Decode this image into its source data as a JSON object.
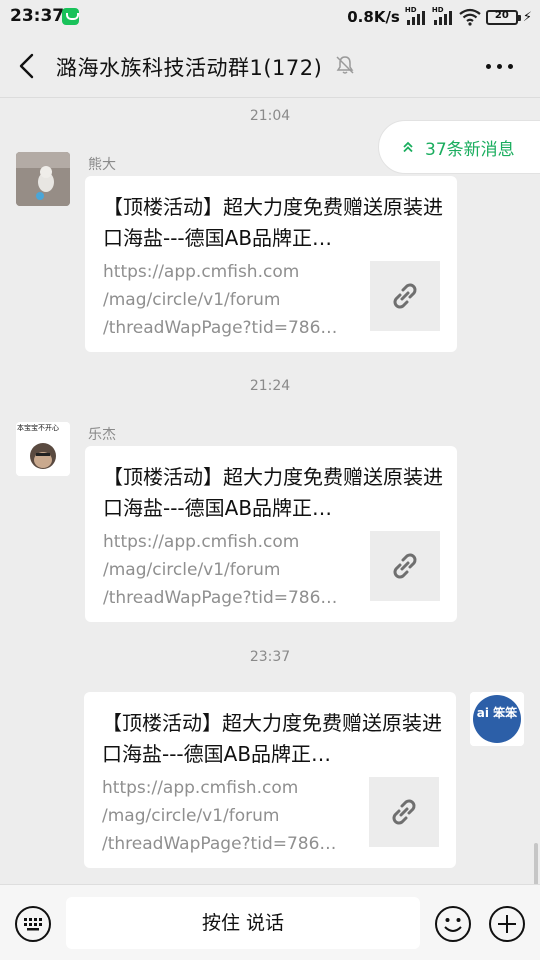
{
  "status_bar": {
    "time": "23:37",
    "speed": "0.8K/s",
    "signal_hd": "HD",
    "battery": "20"
  },
  "header": {
    "title": "潞海水族科技活动群1(172)",
    "icons": [
      "back-icon",
      "mute-icon",
      "more-icon"
    ]
  },
  "new_messages": "37条新消息",
  "messages": [
    {
      "time": "21:04",
      "sender": "熊大",
      "title": "【顶楼活动】超大力度免费赠送原装进口海盐---德国AB品牌正…",
      "url_lines": [
        "https://app.cmfish.com",
        "/mag/circle/v1/forum",
        "/threadWapPage?tid=786…"
      ]
    },
    {
      "time": "21:24",
      "sender": "乐杰",
      "avatar_text": "本宝宝不开心",
      "title": "【顶楼活动】超大力度免费赠送原装进口海盐---德国AB品牌正…",
      "url_lines": [
        "https://app.cmfish.com",
        "/mag/circle/v1/forum",
        "/threadWapPage?tid=786…"
      ]
    },
    {
      "time": "23:37",
      "sender": "",
      "avatar_text": "ai 笨笨",
      "title": "【顶楼活动】超大力度免费赠送原装进口海盐---德国AB品牌正…",
      "url_lines": [
        "https://app.cmfish.com",
        "/mag/circle/v1/forum",
        "/threadWapPage?tid=786…"
      ]
    }
  ],
  "input_bar": {
    "hold_to_talk": "按住 说话"
  },
  "colors": {
    "accent_green": "#1aad5e",
    "background": "#ededed",
    "bubble": "#ffffff"
  }
}
